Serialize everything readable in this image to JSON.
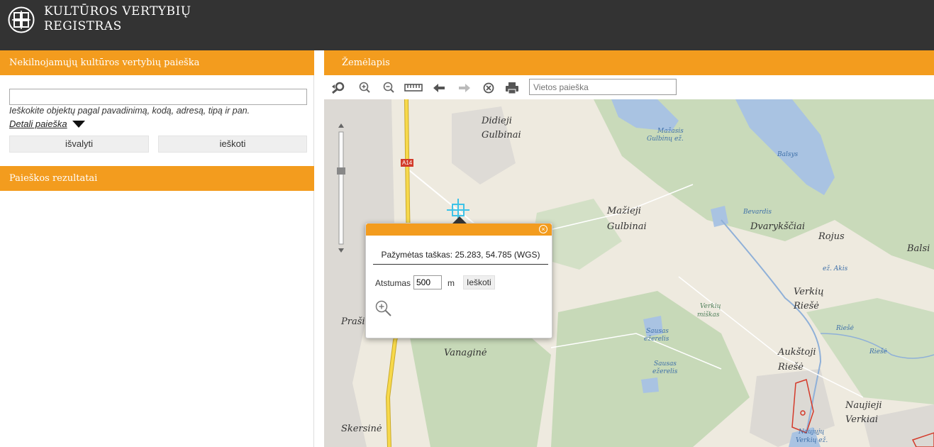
{
  "app": {
    "logo_line1": "KULTŪROS VERTYBIŲ",
    "logo_line2": "REGISTRAS",
    "logo_icon": "registry-logo-icon"
  },
  "search_panel": {
    "title": "Nekilnojamųjų kultūros vertybių paieška",
    "input_value": "",
    "hint": "Ieškokite objektų pagal pavadinimą, kodą, adresą, tipą ir pan.",
    "detail_link": "Detali paieška",
    "clear_label": "išvalyti",
    "search_label": "ieškoti"
  },
  "results_panel": {
    "title": "Paieškos rezultatai"
  },
  "map_panel": {
    "title": "Žemėlapis",
    "place_search_placeholder": "Vietos paieška",
    "tools": [
      "zoom-to-extent-icon",
      "zoom-in-icon",
      "zoom-out-icon",
      "ruler-icon",
      "back-arrow-icon",
      "forward-arrow-icon",
      "clear-icon",
      "print-icon"
    ]
  },
  "popup": {
    "title": "Pažymėtas taškas: 25.283, 54.785 (WGS)",
    "distance_label": "Atstumas",
    "distance_value": "500",
    "distance_unit": "m",
    "search_label": "Ieškoti",
    "zoom_icon": "zoom-in-icon"
  },
  "map_labels": [
    {
      "text": "Didieji",
      "kind": "place"
    },
    {
      "text": "Gulbinai",
      "kind": "place"
    },
    {
      "text": "Mažieji",
      "kind": "place"
    },
    {
      "text": "Gulbinai",
      "kind": "place"
    },
    {
      "text": "Dvarykščiai",
      "kind": "place"
    },
    {
      "text": "Rojus",
      "kind": "place"
    },
    {
      "text": "Balsi",
      "kind": "place"
    },
    {
      "text": "Verkių",
      "kind": "place"
    },
    {
      "text": "Riešė",
      "kind": "place"
    },
    {
      "text": "Praši",
      "kind": "place"
    },
    {
      "text": "Vanaginė",
      "kind": "place"
    },
    {
      "text": "Aukštoji",
      "kind": "place"
    },
    {
      "text": "Riešė",
      "kind": "place"
    },
    {
      "text": "Naujieji",
      "kind": "place"
    },
    {
      "text": "Verkiai",
      "kind": "place"
    },
    {
      "text": "Skersinė",
      "kind": "place"
    },
    {
      "text": "Mažasis",
      "kind": "water"
    },
    {
      "text": "Gulbinų ež.",
      "kind": "water"
    },
    {
      "text": "Balsys",
      "kind": "water"
    },
    {
      "text": "Bevardis",
      "kind": "water"
    },
    {
      "text": "ež. Akis",
      "kind": "water"
    },
    {
      "text": "Riešė",
      "kind": "water"
    },
    {
      "text": "Riešė",
      "kind": "water"
    },
    {
      "text": "Sausas",
      "kind": "water"
    },
    {
      "text": "ežerelis",
      "kind": "water"
    },
    {
      "text": "Sausas",
      "kind": "water"
    },
    {
      "text": "ežerelis",
      "kind": "water"
    },
    {
      "text": "Naujųjų",
      "kind": "water"
    },
    {
      "text": "Verkių ež.",
      "kind": "water"
    },
    {
      "text": "Verkių",
      "kind": "forest"
    },
    {
      "text": "miškas",
      "kind": "forest"
    }
  ],
  "road_shield": "A14",
  "colors": {
    "accent": "#f39c1e",
    "header": "#333333",
    "water": "#a9c3e2",
    "forest": "#c2d7b4",
    "urban": "#dcd9d4",
    "road": "#f7d94b"
  }
}
